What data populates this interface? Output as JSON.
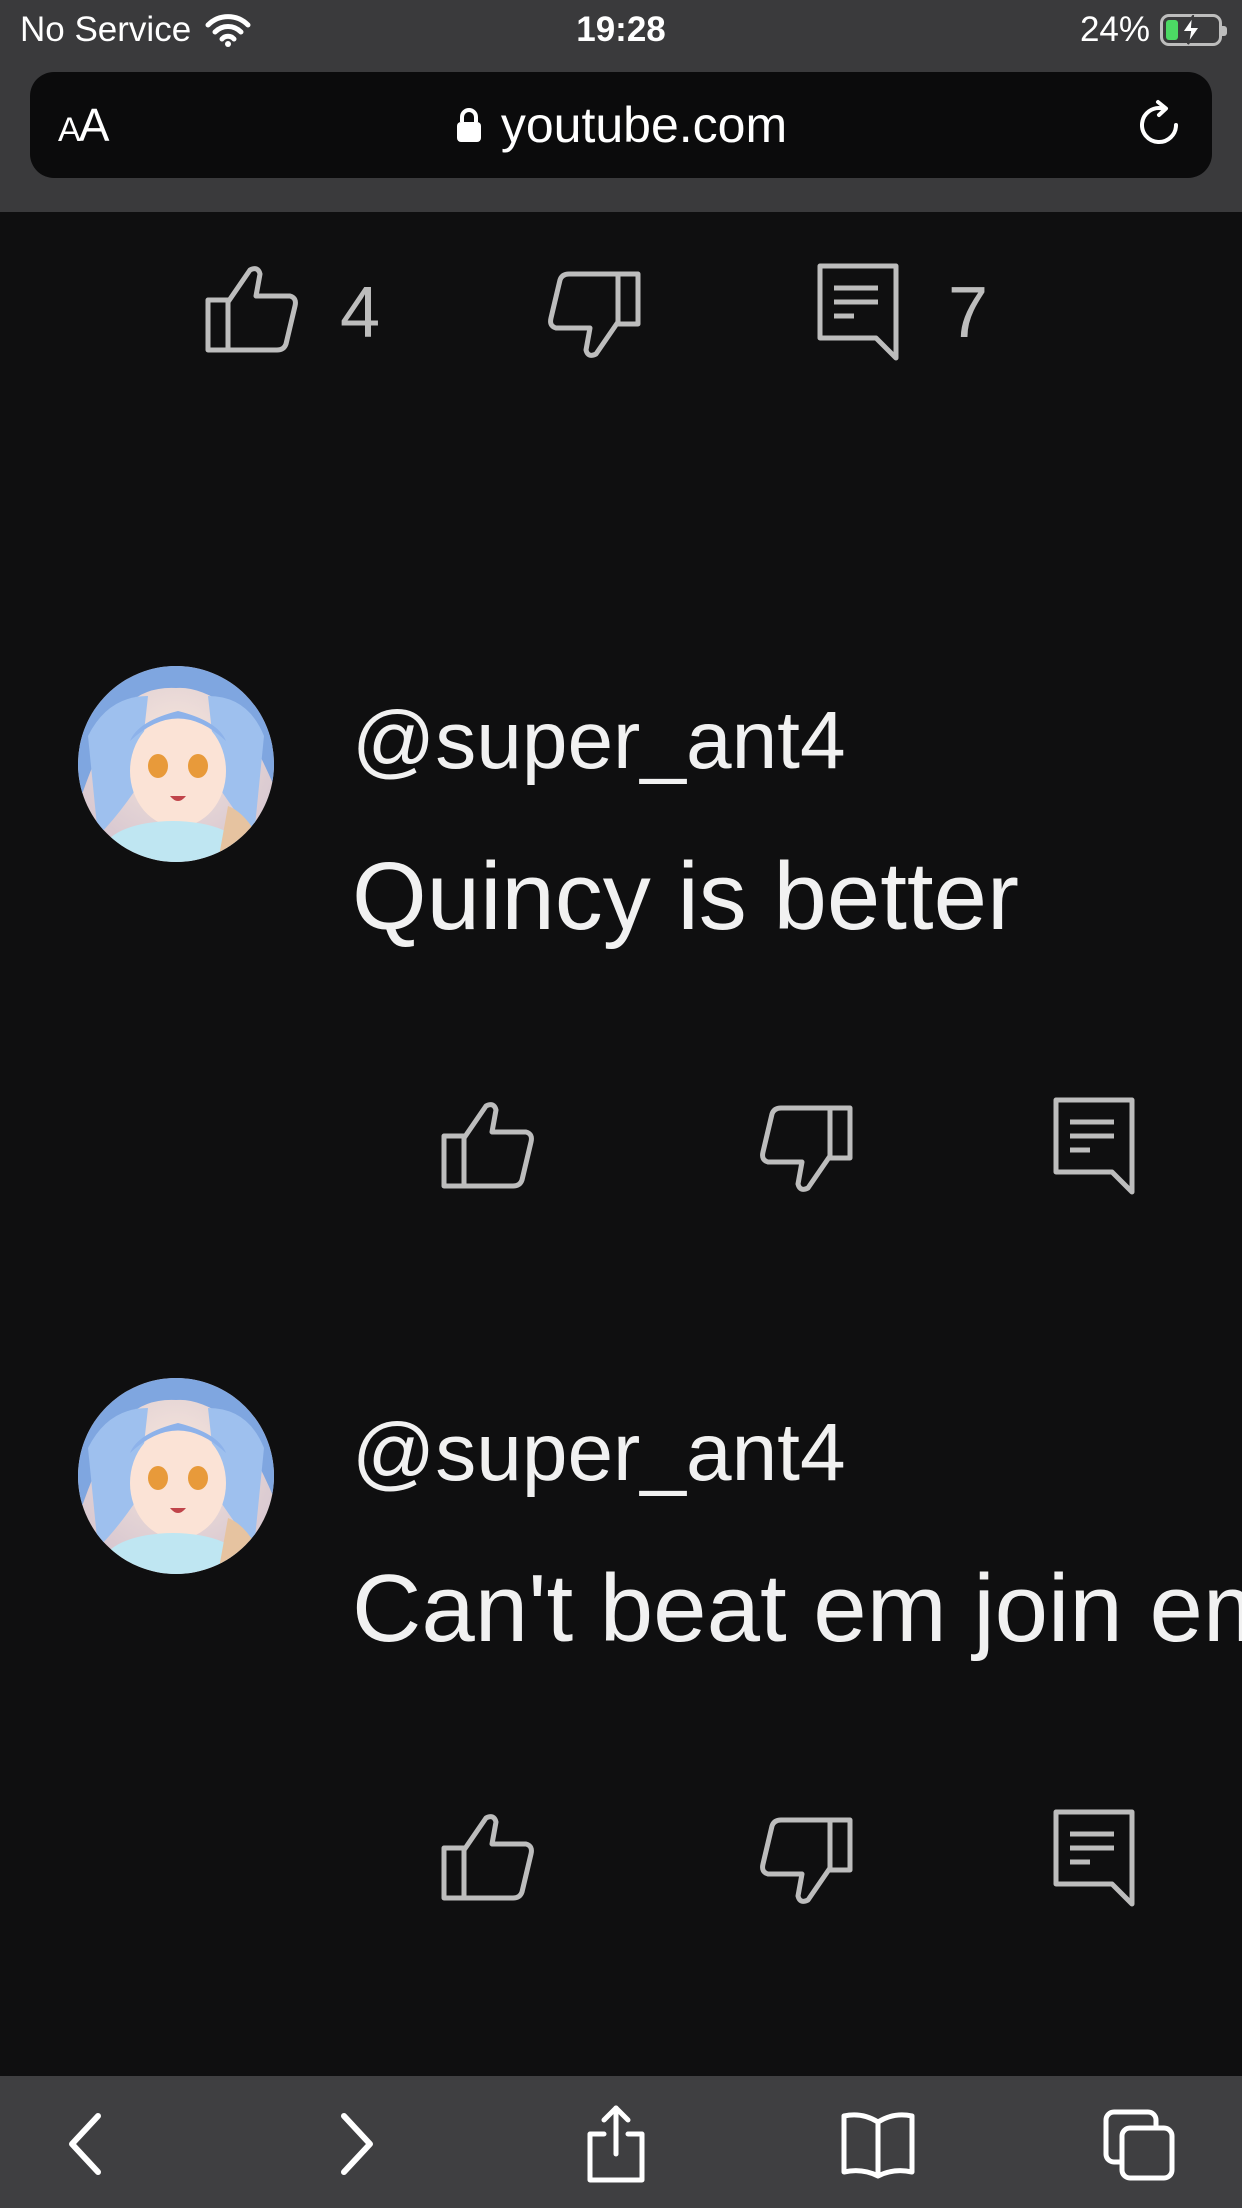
{
  "status_bar": {
    "carrier": "No Service",
    "time": "19:28",
    "battery": "24%",
    "battery_level": 0.24
  },
  "browser": {
    "text_size_label_small": "A",
    "text_size_label_large": "A",
    "url": "youtube.com"
  },
  "top_actions": {
    "like_count": "4",
    "reply_count": "7"
  },
  "comments": [
    {
      "handle": "@super_ant4",
      "text": "Quincy is better"
    },
    {
      "handle": "@super_ant4",
      "text": "Can't beat em join em"
    }
  ],
  "colors": {
    "background": "#0f0f10",
    "chrome": "#3a3a3c",
    "icon_stroke": "#bdbdbd"
  }
}
